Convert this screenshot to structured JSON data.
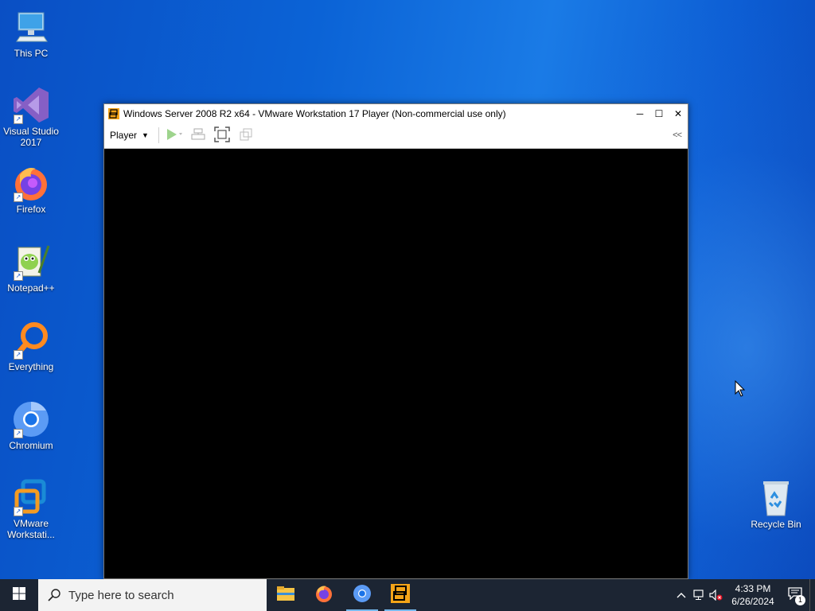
{
  "desktop": {
    "icons": [
      {
        "label": "This PC",
        "icon": "computer-icon"
      },
      {
        "label": "Visual Studio 2017",
        "icon": "visual-studio-icon"
      },
      {
        "label": "Firefox",
        "icon": "firefox-icon"
      },
      {
        "label": "Notepad++",
        "icon": "notepadpp-icon"
      },
      {
        "label": "Everything",
        "icon": "everything-search-icon"
      },
      {
        "label": "Chromium",
        "icon": "chromium-icon"
      },
      {
        "label": "VMware Workstati...",
        "icon": "vmware-icon"
      }
    ],
    "recycle_bin": {
      "label": "Recycle Bin",
      "icon": "recycle-bin-icon"
    }
  },
  "vm_window": {
    "title": "Windows Server 2008 R2 x64 - VMware Workstation 17 Player (Non-commercial use only)",
    "menu": {
      "player_label": "Player"
    },
    "collapse_label": "<<",
    "controls": {
      "minimize": "─",
      "maximize": "☐",
      "close": "✕"
    }
  },
  "taskbar": {
    "search_placeholder": "Type here to search",
    "apps": [
      "file-explorer-icon",
      "firefox-icon",
      "chromium-icon",
      "vmware-icon"
    ],
    "clock": {
      "time": "4:33 PM",
      "date": "6/26/2024"
    },
    "notification_count": "1"
  },
  "colors": {
    "accent": "#76b9ed",
    "taskbar_bg": "#1c2533",
    "wallpaper": "#0b63d6"
  }
}
